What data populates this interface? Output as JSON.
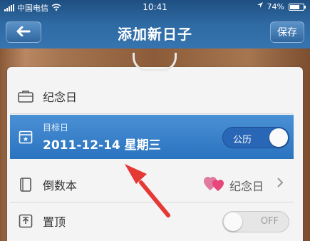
{
  "status_bar": {
    "carrier": "中国电信",
    "time": "10:41",
    "battery": "74%",
    "battery_level": 0.74
  },
  "nav": {
    "title": "添加新日子",
    "save_label": "保存"
  },
  "rows": {
    "anniversary": {
      "label": "纪念日"
    },
    "target_date": {
      "label": "目标日",
      "date": "2011-12-14 星期三",
      "calendar_toggle_label": "公历",
      "calendar_toggle_on": true
    },
    "countdown_book": {
      "label": "倒数本",
      "value": "纪念日"
    },
    "pin_top": {
      "label": "置顶",
      "toggle_label": "OFF",
      "toggle_on": false
    }
  },
  "colors": {
    "accent_blue": "#2a73bf",
    "annotation_arrow": "#e53935",
    "heart": "#e8467a"
  },
  "icons": [
    "signal-icon",
    "wifi-icon",
    "location-icon",
    "battery-icon",
    "back-arrow-icon",
    "briefcase-icon",
    "calendar-icon",
    "book-icon",
    "pin-top-icon",
    "hearts-icon",
    "chevron-right-icon"
  ]
}
